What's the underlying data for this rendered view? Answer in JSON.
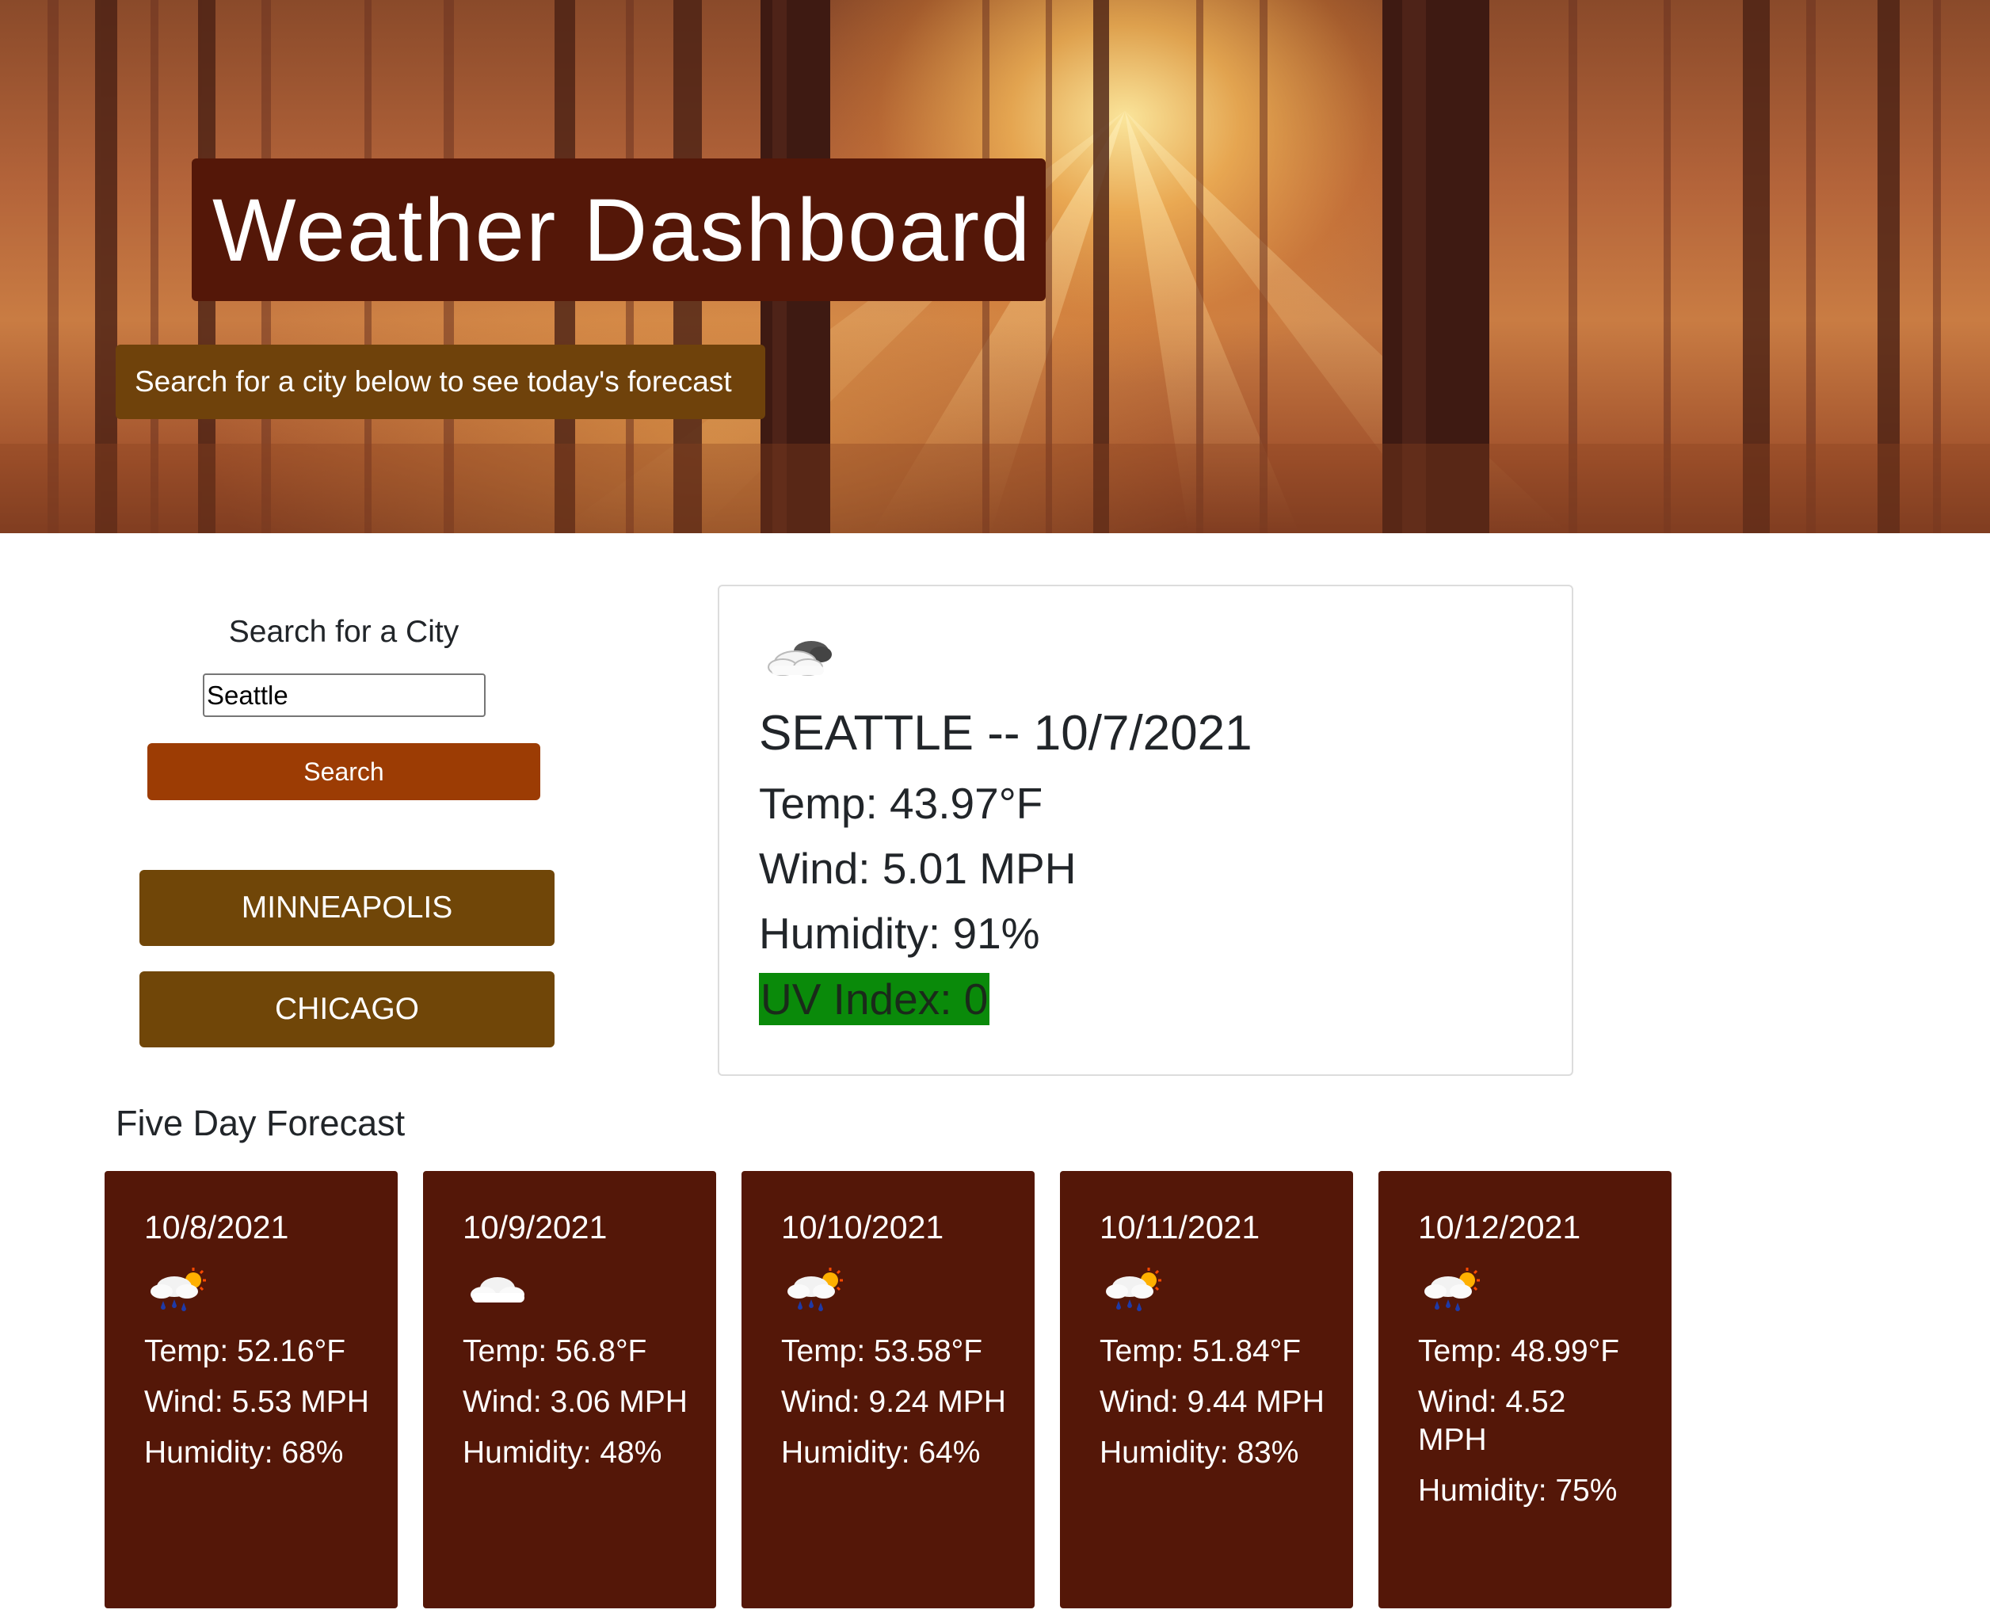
{
  "header": {
    "title": "Weather Dashboard",
    "subtitle": "Search for a city below to see today's forecast"
  },
  "search": {
    "heading": "Search for a City",
    "input_value": "Seattle",
    "button_label": "Search"
  },
  "history": [
    {
      "label": "MINNEAPOLIS"
    },
    {
      "label": "CHICAGO"
    }
  ],
  "current": {
    "icon": "partly-cloudy-icon",
    "title": "SEATTLE -- 10/7/2021",
    "temp": "Temp: 43.97°F",
    "wind": "Wind: 5.01 MPH",
    "humidity": "Humidity: 91%",
    "uv": "UV Index: 0",
    "uv_color": "#0a8a0a"
  },
  "forecast": {
    "heading": "Five Day Forecast",
    "days": [
      {
        "date": "10/8/2021",
        "icon": "rain-sun-icon",
        "temp": "Temp: 52.16°F",
        "wind": "Wind: 5.53 MPH",
        "humidity": "Humidity: 68%"
      },
      {
        "date": "10/9/2021",
        "icon": "cloud-icon",
        "temp": "Temp: 56.8°F",
        "wind": "Wind: 3.06 MPH",
        "humidity": "Humidity: 48%"
      },
      {
        "date": "10/10/2021",
        "icon": "rain-sun-icon",
        "temp": "Temp: 53.58°F",
        "wind": "Wind: 9.24 MPH",
        "humidity": "Humidity: 64%"
      },
      {
        "date": "10/11/2021",
        "icon": "rain-sun-icon",
        "temp": "Temp: 51.84°F",
        "wind": "Wind: 9.44 MPH",
        "humidity": "Humidity: 83%"
      },
      {
        "date": "10/12/2021",
        "icon": "rain-sun-icon",
        "temp": "Temp: 48.99°F",
        "wind": "Wind: 4.52 MPH",
        "humidity": "Humidity: 75%"
      }
    ]
  },
  "colors": {
    "header_title_bg": "#541708",
    "header_subtitle_bg": "#6f420b",
    "search_button_bg": "#9c3c04",
    "history_button_bg": "#704608",
    "forecast_card_bg": "#541708"
  }
}
